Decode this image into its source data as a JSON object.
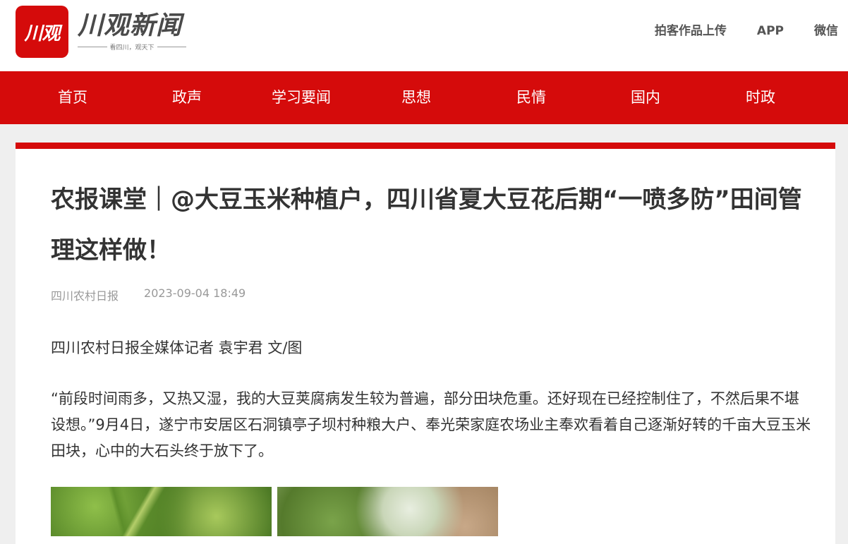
{
  "header": {
    "logo_mark": "川观",
    "logo_text": "川观新闻",
    "slogan": "看四川，观天下",
    "links": [
      "拍客作品上传",
      "APP",
      "微信"
    ]
  },
  "nav": {
    "items": [
      "首页",
      "政声",
      "学习要闻",
      "思想",
      "民情",
      "国内",
      "时政"
    ]
  },
  "article": {
    "title": "农报课堂｜@大豆玉米种植户，四川省夏大豆花后期“一喷多防”田间管理这样做！",
    "source": "四川农村日报",
    "datetime": "2023-09-04 18:49",
    "byline": "四川农村日报全媒体记者 袁宇君 文/图",
    "paragraph": "“前段时间雨多，又热又湿，我的大豆荚腐病发生较为普遍，部分田块危重。还好现在已经控制住了，不然后果不堪设想。”9月4日，遂宁市安居区石洞镇亭子坝村种粮大户、奉光荣家庭农场业主奉欢看着自己逐渐好转的千亩大豆玉米田块，心中的大石头终于放下了。"
  },
  "colors": {
    "brand_red": "#d50b0b",
    "page_bg": "#efefef"
  }
}
